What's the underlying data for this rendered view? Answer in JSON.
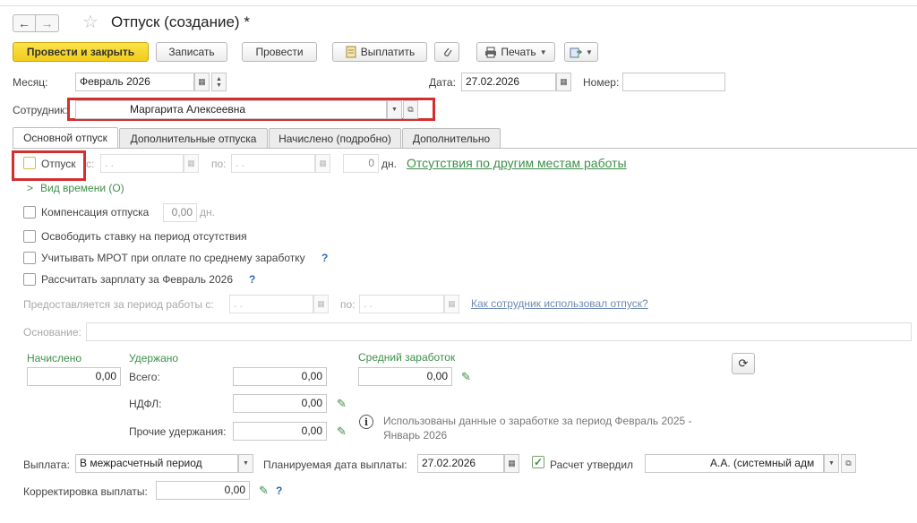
{
  "window": {
    "title": "Отпуск (создание) *"
  },
  "nav": {
    "back_icon": "←",
    "forward_icon": "→",
    "favorite_icon": "☆"
  },
  "toolbar": {
    "post_close": "Провести и закрыть",
    "save": "Записать",
    "post": "Провести",
    "pay": "Выплатить",
    "print": "Печать"
  },
  "header": {
    "month_label": "Месяц:",
    "month_value": "Февраль 2026",
    "date_label": "Дата:",
    "date_value": "27.02.2026",
    "number_label": "Номер:",
    "number_value": "",
    "employee_label": "Сотрудник:",
    "employee_value": "Маргарита Алексеевна"
  },
  "tabs": [
    {
      "label": "Основной отпуск",
      "active": true
    },
    {
      "label": "Дополнительные отпуска",
      "active": false
    },
    {
      "label": "Начислено (подробно)",
      "active": false
    },
    {
      "label": "Дополнительно",
      "active": false
    }
  ],
  "vacation": {
    "label": "Отпуск",
    "from_label": "с:",
    "from_value": " .  .",
    "to_label": "по:",
    "to_value": " .  .",
    "days_value": "0",
    "days_unit": "дн.",
    "other_link": "Отсутствия по другим местам работы",
    "time_kind": "Вид времени (О)",
    "compensation_label": "Компенсация отпуска",
    "compensation_value": "0,00",
    "compensation_unit": "дн.",
    "free_rate": "Освободить ставку на период отсутствия",
    "mrot": "Учитывать МРОТ при оплате по среднему заработку",
    "calc_salary": "Рассчитать зарплату за Февраль 2026",
    "help": "?"
  },
  "period": {
    "label": "Предоставляется за период работы с:",
    "from_value": " .  .",
    "to_label": "по:",
    "to_value": " .  .",
    "link": "Как сотрудник использовал отпуск?"
  },
  "basis": {
    "label": "Основание:",
    "value": ""
  },
  "totals": {
    "accrued_label": "Начислено",
    "accrued_value": "0,00",
    "withheld_label": "Удержано",
    "total_label": "Всего:",
    "total_value": "0,00",
    "ndfl_label": "НДФЛ:",
    "ndfl_value": "0,00",
    "other_label": "Прочие удержания:",
    "other_value": "0,00",
    "avg_label": "Средний заработок",
    "avg_value": "0,00",
    "info_text_1": "Использованы данные о заработке за период Февраль 2025 -",
    "info_text_2": "Январь 2026"
  },
  "payment": {
    "label": "Выплата:",
    "value": "В межрасчетный период",
    "planned_label": "Планируемая дата выплаты:",
    "planned_value": "27.02.2026",
    "approved_label": "Расчет утвердил",
    "approved_value": "А.А. (системный адм",
    "correction_label": "Корректировка выплаты:",
    "correction_value": "0,00"
  },
  "colors": {
    "accent_yellow": "#f1cc1a",
    "green": "#3d8f4a",
    "red_highlight": "#d42f2f"
  }
}
